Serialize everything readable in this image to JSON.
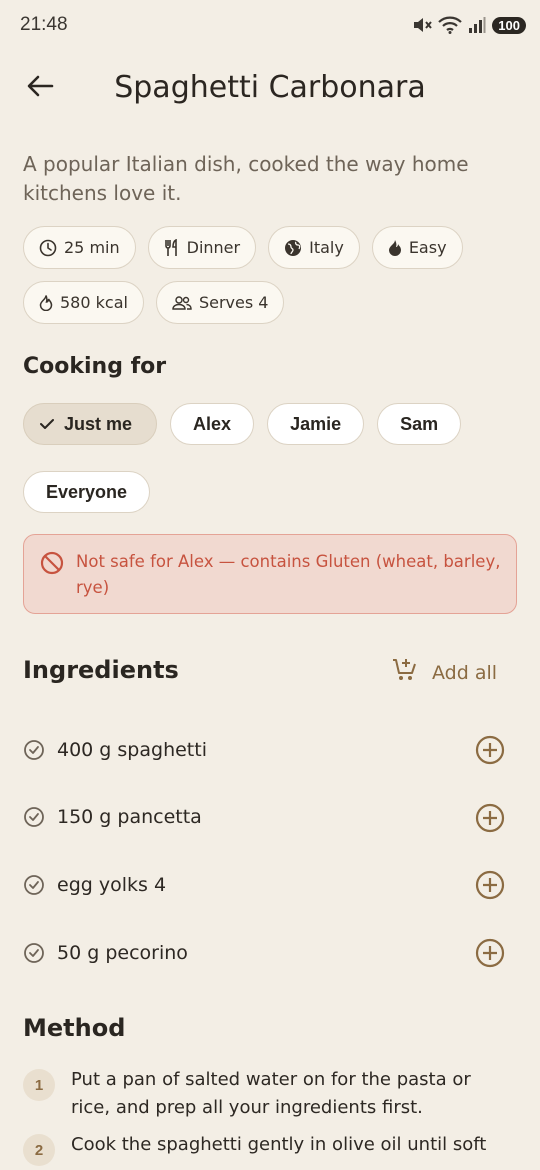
{
  "status": {
    "time": "21:48",
    "battery": "100"
  },
  "header": {
    "title": "Spaghetti Carbonara",
    "back_icon": "arrow-left-icon"
  },
  "recipe": {
    "description": "A popular Italian dish, cooked the way home kitchens love it.",
    "chips": [
      {
        "icon": "clock-icon",
        "label": "25 min"
      },
      {
        "icon": "utensils-icon",
        "label": "Dinner"
      },
      {
        "icon": "globe-icon",
        "label": "Italy"
      },
      {
        "icon": "flame-icon",
        "label": "Easy"
      },
      {
        "icon": "flame-icon",
        "label": "580 kcal"
      },
      {
        "icon": "people-icon",
        "label": "Serves 4"
      }
    ]
  },
  "cooking_for": {
    "heading": "Cooking for",
    "options": [
      "Just me",
      "Alex",
      "Jamie",
      "Sam",
      "Everyone"
    ],
    "selected": "Just me"
  },
  "alert": {
    "icon": "block-icon",
    "text": "Not safe for Alex — contains Gluten (wheat, barley, rye)"
  },
  "ingredients": {
    "heading": "Ingredients",
    "add_all_label": "Add all",
    "items": [
      "400 g spaghetti",
      "150 g pancetta",
      "egg yolks 4",
      "50 g pecorino"
    ]
  },
  "method": {
    "heading": "Method",
    "steps": [
      {
        "num": "1",
        "text": "Put a pan of salted water on for the pasta or rice, and prep all your ingredients first."
      },
      {
        "num": "2",
        "text": "Cook the spaghetti gently in olive oil until soft"
      }
    ]
  },
  "colors": {
    "background": "#f3eee5",
    "accent": "#8b6b42",
    "alert": "#c7533f"
  }
}
